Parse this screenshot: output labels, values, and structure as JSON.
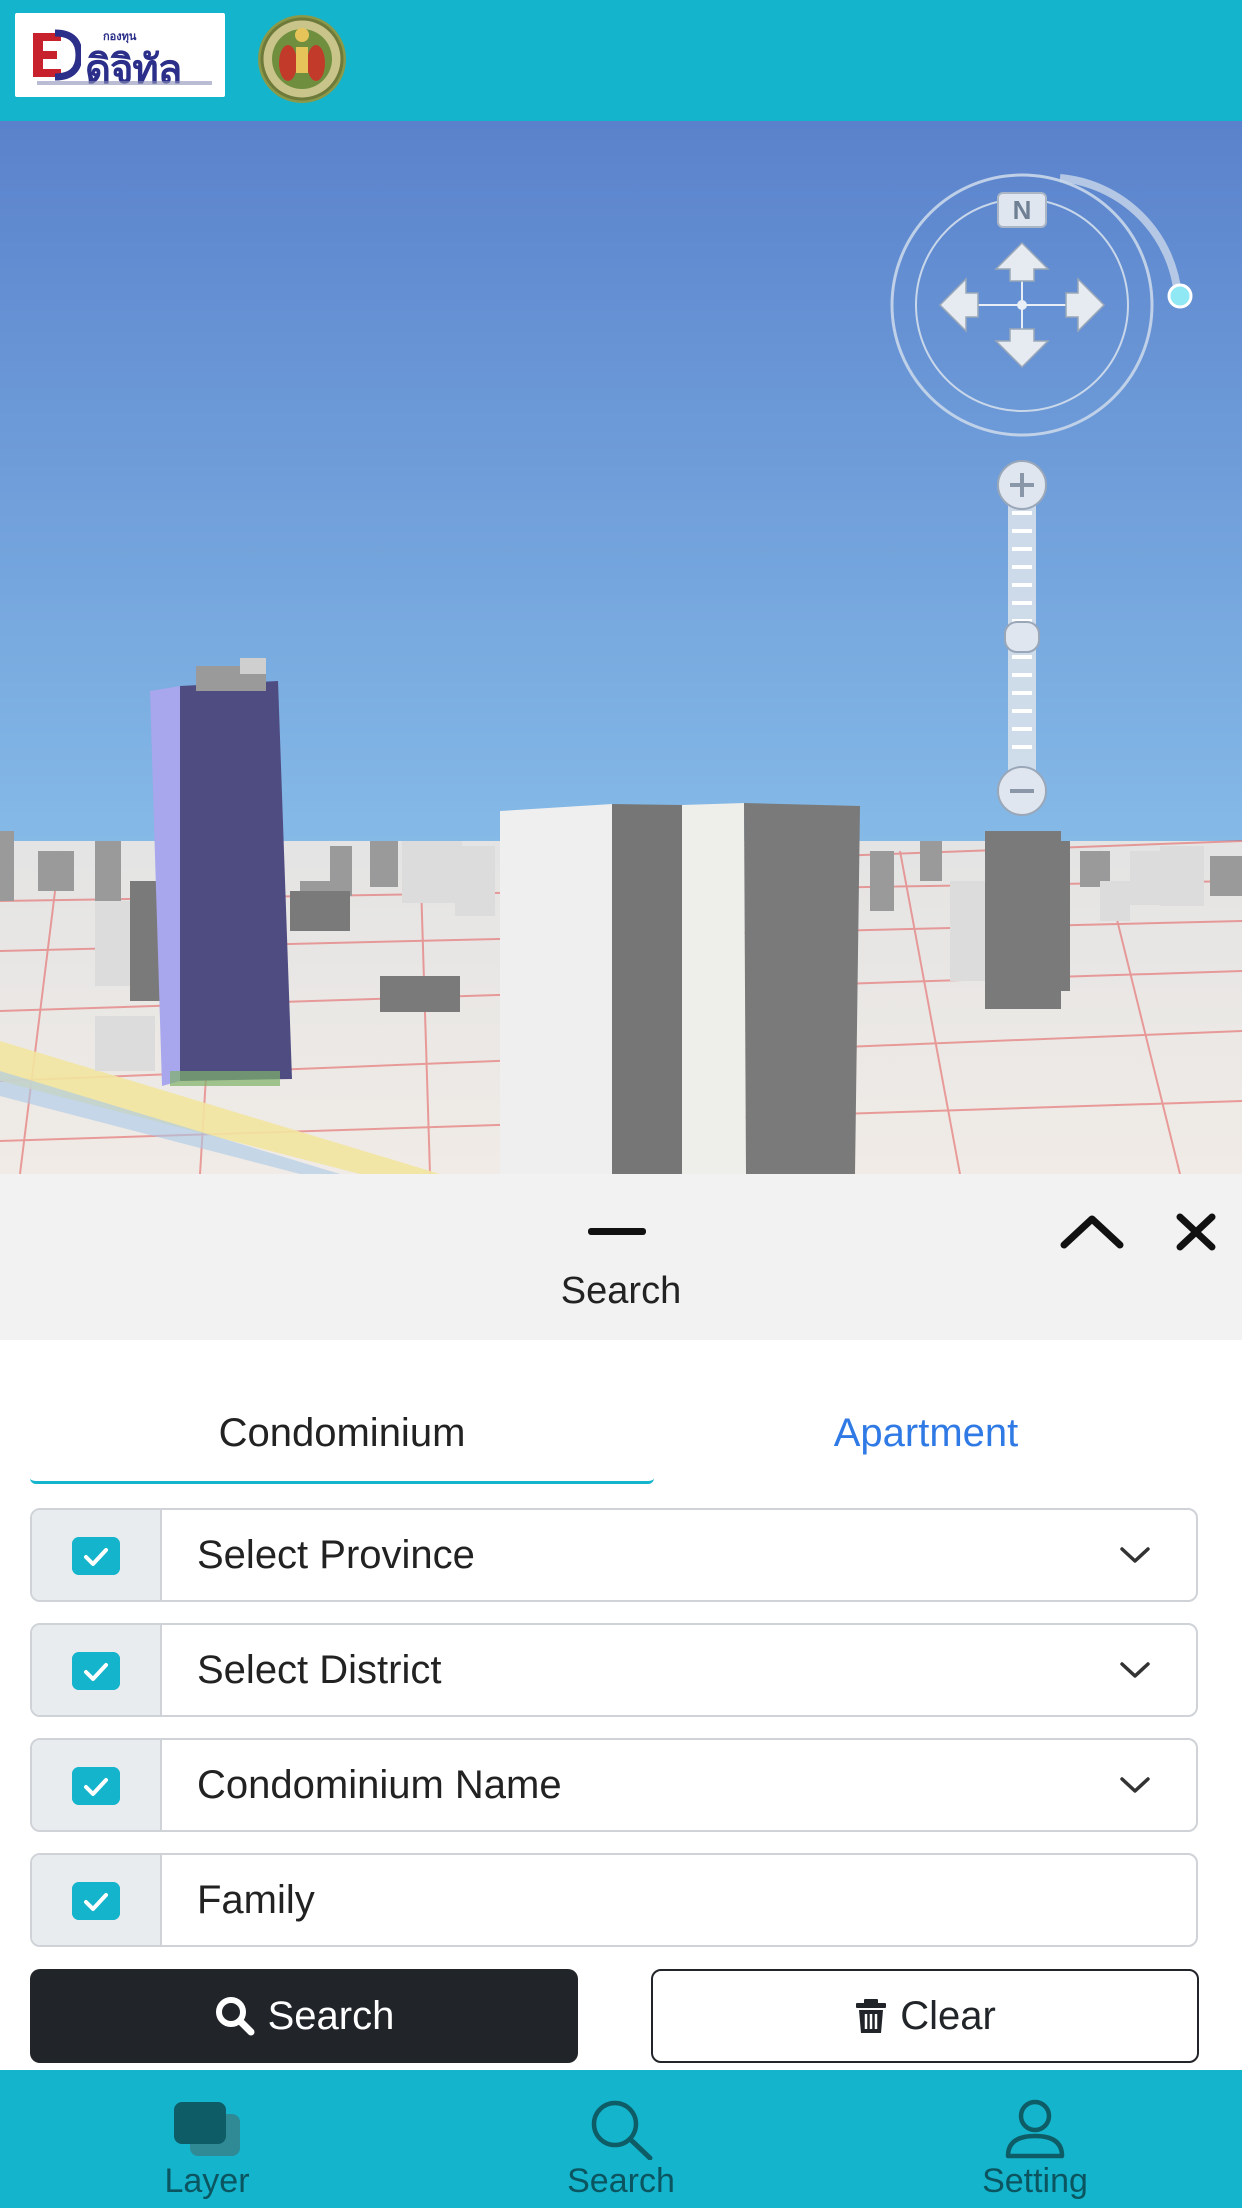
{
  "header": {
    "logo_text": "ดิจิทัล",
    "logo_small_text": "กองทุน",
    "logo_icon": "digital-fund-logo",
    "seal_icon": "bangkok-seal-emblem"
  },
  "map": {
    "compass_label": "N",
    "icons": [
      "compass-icon",
      "pan-up-icon",
      "pan-down-icon",
      "pan-left-icon",
      "pan-right-icon",
      "zoom-in-icon",
      "zoom-out-icon"
    ],
    "zoom_level": 0.5
  },
  "panel": {
    "title": "Search",
    "tabs": [
      {
        "label": "Condominium",
        "active": true
      },
      {
        "label": "Apartment",
        "active": false
      }
    ],
    "fields": [
      {
        "label": "Select Province",
        "checked": true,
        "dropdown": true
      },
      {
        "label": "Select District",
        "checked": true,
        "dropdown": true
      },
      {
        "label": "Condominium Name",
        "checked": true,
        "dropdown": true
      },
      {
        "label": "Family",
        "checked": true,
        "dropdown": false
      }
    ],
    "search_label": "Search",
    "clear_label": "Clear"
  },
  "nav": {
    "items": [
      {
        "label": "Layer",
        "icon": "layers-icon"
      },
      {
        "label": "Search",
        "icon": "search-icon"
      },
      {
        "label": "Setting",
        "icon": "user-icon"
      }
    ]
  },
  "colors": {
    "accent": "#14b4cc",
    "tab_link": "#2f7ae5",
    "dark_button": "#212529",
    "sky_top": "#5a82cc",
    "sky_bottom": "#9fd0ee"
  }
}
